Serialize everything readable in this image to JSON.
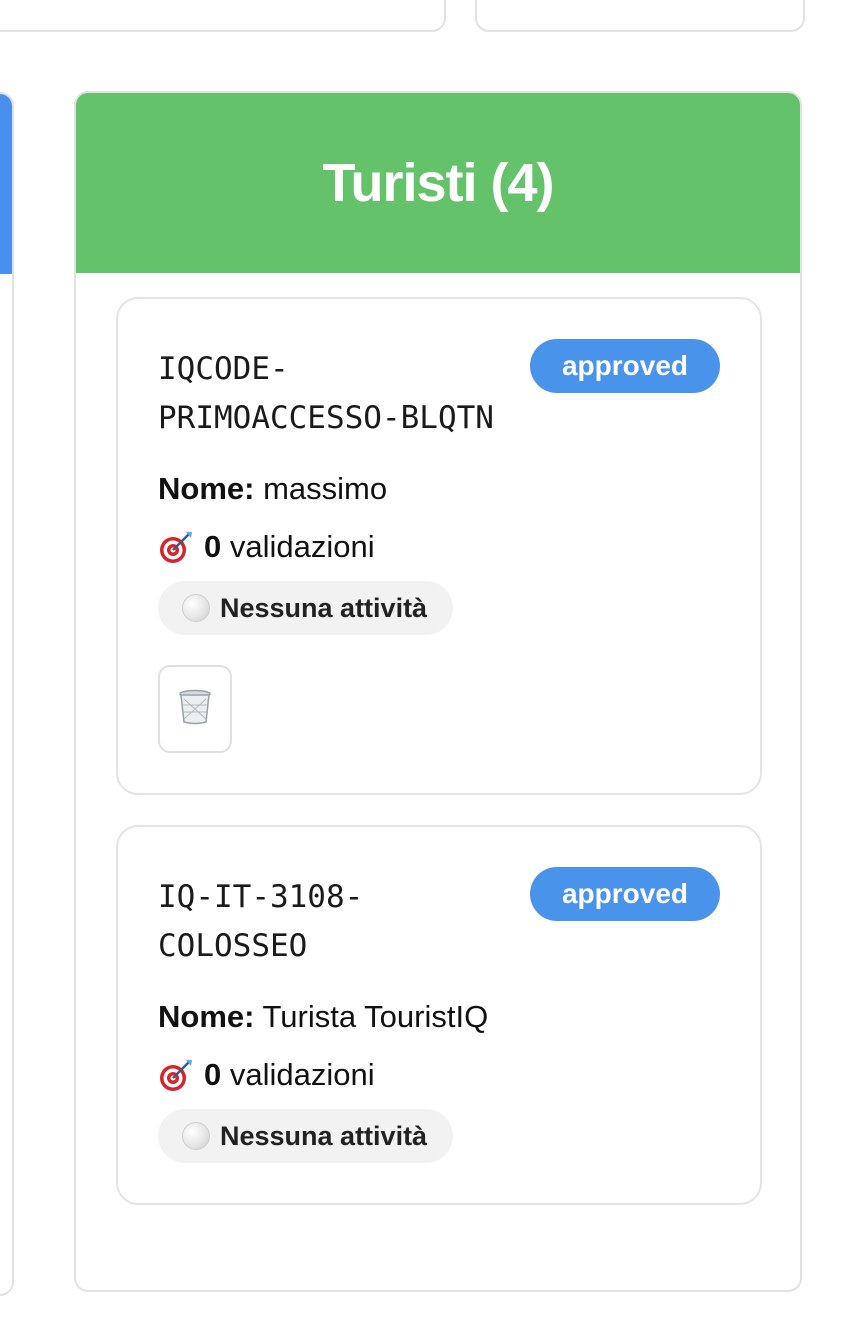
{
  "panel": {
    "title": "Turisti (4)",
    "header_color": "#63c26a"
  },
  "tourists": [
    {
      "code": "IQCODE-PRIMOACCESSO-BLQTN",
      "status": "approved",
      "name_label": "Nome:",
      "name": "massimo",
      "validations_count": "0",
      "validations_label": "validazioni",
      "activity": "Nessuna attività",
      "delete_icon": "trash-icon"
    },
    {
      "code": "IQ-IT-3108-COLOSSEO",
      "status": "approved",
      "name_label": "Nome:",
      "name": "Turista TouristIQ",
      "validations_count": "0",
      "validations_label": "validazioni",
      "activity": "Nessuna attività"
    }
  ],
  "colors": {
    "badge": "#4a93ea",
    "left_panel_accent": "#4a8ef0"
  }
}
